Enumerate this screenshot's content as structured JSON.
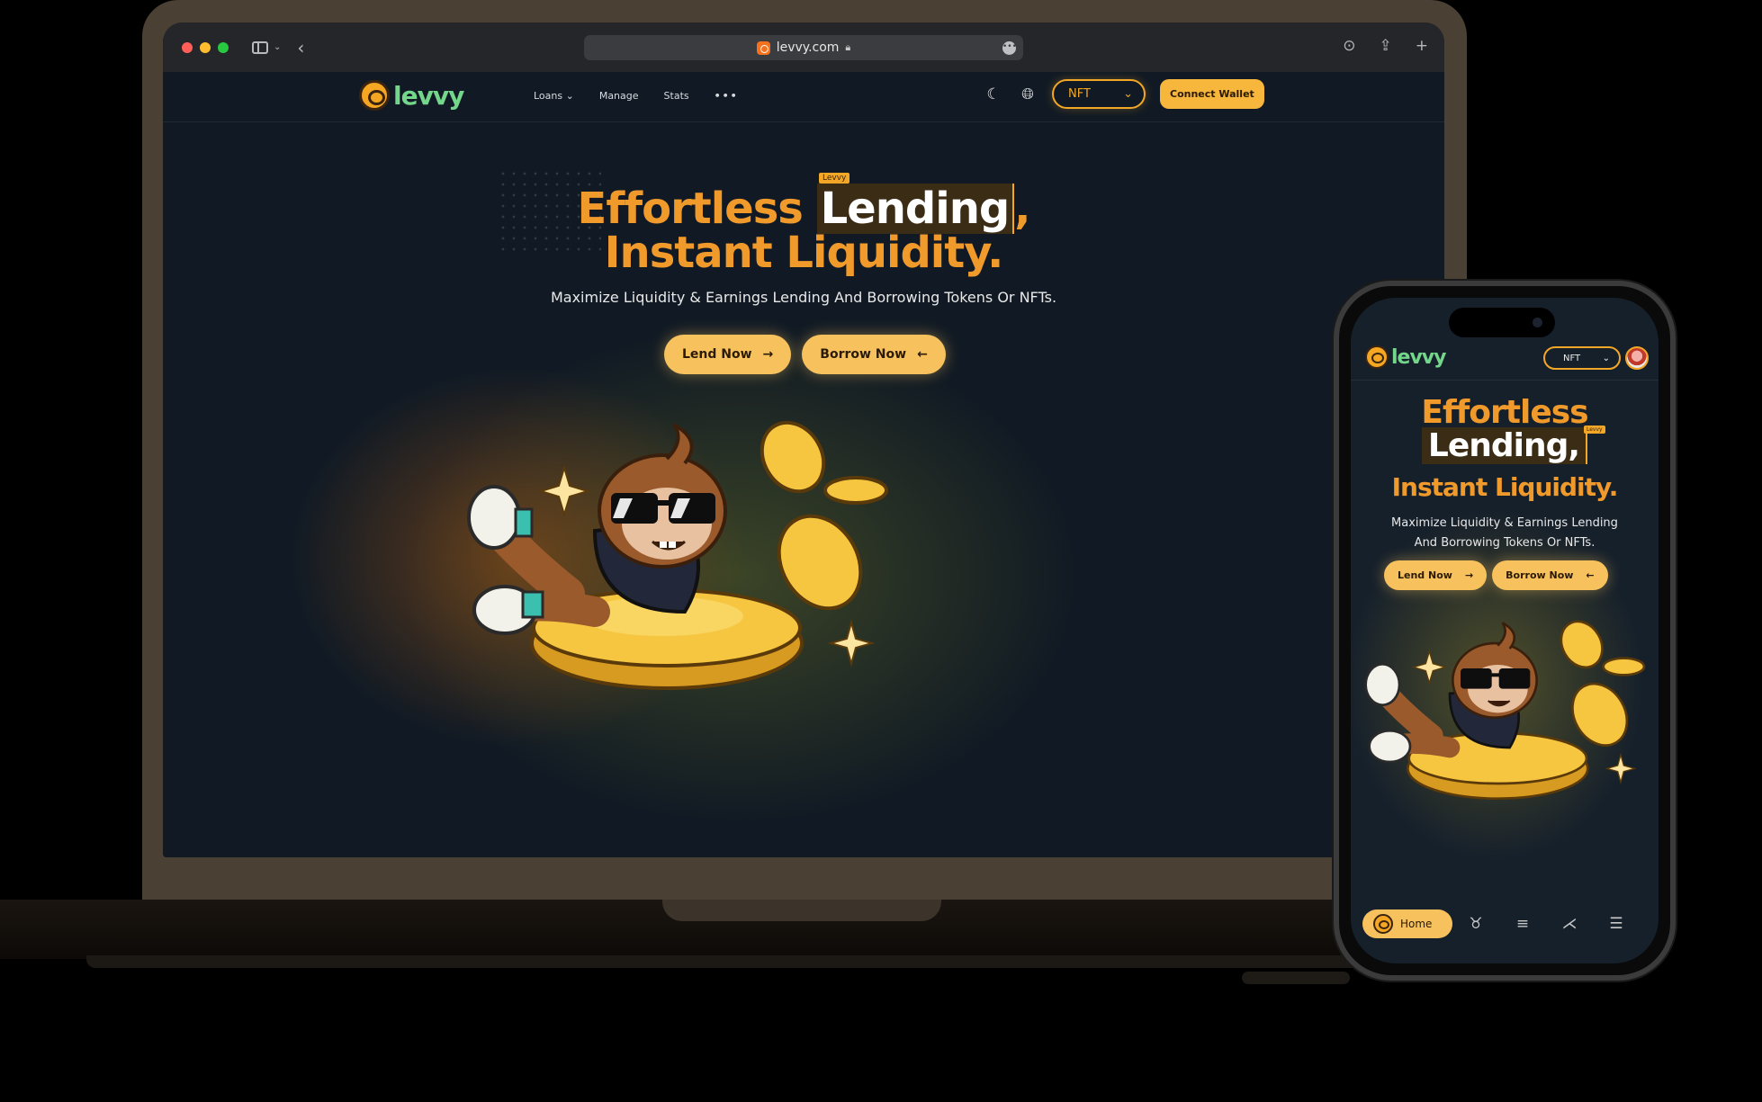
{
  "browser": {
    "url": "levvy.com"
  },
  "site": {
    "brand": "Levvy",
    "nav": {
      "loans": "Loans",
      "manage": "Manage",
      "stats": "Stats",
      "more": "•••"
    },
    "nft_select": "NFT",
    "connect_wallet": "Connect Wallet"
  },
  "hero": {
    "line1_prefix": "Effortless ",
    "line1_highlight": "Lending",
    "line1_suffix": ",",
    "line2": "Instant Liquidity.",
    "tag": "Levvy",
    "subtitle": "Maximize Liquidity & Earnings Lending And Borrowing Tokens Or NFTs.",
    "lend_button": "Lend Now",
    "borrow_button": "Borrow Now"
  },
  "mobile": {
    "line1": "Effortless",
    "line2": "Lending,",
    "line3": "Instant Liquidity.",
    "tag": "Levvy",
    "subtitle_line1": "Maximize Liquidity & Earnings Lending",
    "subtitle_line2": "And Borrowing Tokens Or NFTs.",
    "nft_select": "NFT",
    "lend_button": "Lend Now",
    "borrow_button": "Borrow Now",
    "bottom_nav": {
      "home": "Home"
    }
  },
  "colors": {
    "accent": "#f3a726",
    "title_orange": "#f09a2c",
    "logo_green": "#73d68a",
    "page_bg": "#111a24"
  },
  "icons": [
    "sidebar-icon",
    "back-icon",
    "lock-icon",
    "download-icon",
    "share-icon",
    "new-tab-icon",
    "moon-icon",
    "globe-icon",
    "chevron-down-icon",
    "arrow-right-icon",
    "arrow-left-icon",
    "loans-icon",
    "search-icon",
    "stats-icon",
    "menu-icon"
  ]
}
